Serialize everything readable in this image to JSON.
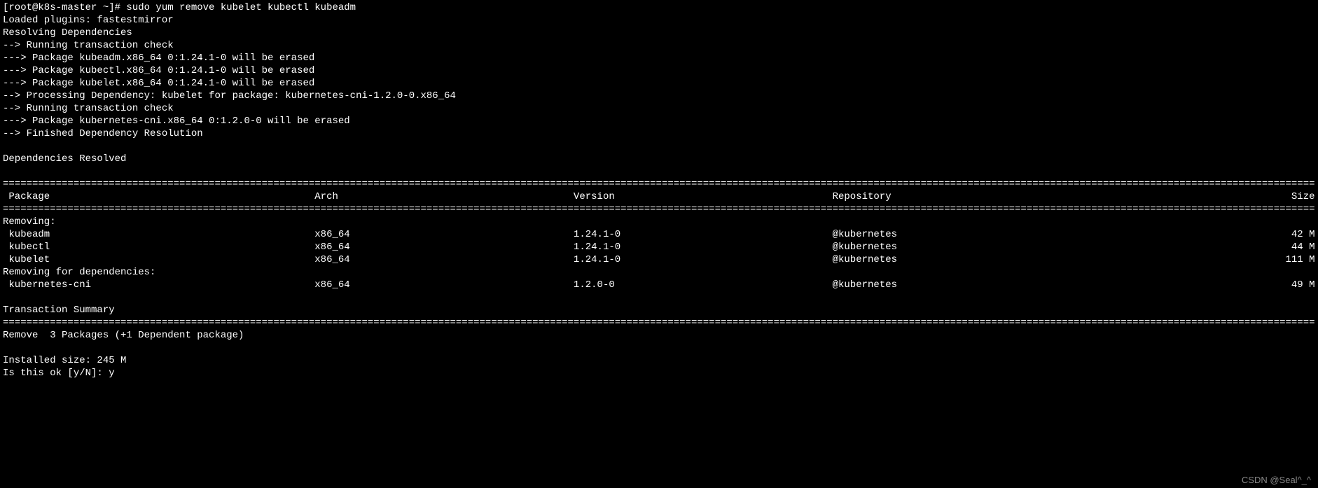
{
  "prompt_line": "[root@k8s-master ~]# sudo yum remove kubelet kubectl kubeadm",
  "header_lines": [
    "Loaded plugins: fastestmirror",
    "Resolving Dependencies",
    "--> Running transaction check",
    "---> Package kubeadm.x86_64 0:1.24.1-0 will be erased",
    "---> Package kubectl.x86_64 0:1.24.1-0 will be erased",
    "---> Package kubelet.x86_64 0:1.24.1-0 will be erased",
    "--> Processing Dependency: kubelet for package: kubernetes-cni-1.2.0-0.x86_64",
    "--> Running transaction check",
    "---> Package kubernetes-cni.x86_64 0:1.2.0-0 will be erased",
    "--> Finished Dependency Resolution",
    "",
    "Dependencies Resolved",
    ""
  ],
  "columns": {
    "package": "Package",
    "arch": "Arch",
    "version": "Version",
    "repository": "Repository",
    "size": "Size"
  },
  "section_removing": "Removing:",
  "rows_removing": [
    {
      "package": "kubeadm",
      "arch": "x86_64",
      "version": "1.24.1-0",
      "repository": "@kubernetes",
      "size": "42 M"
    },
    {
      "package": "kubectl",
      "arch": "x86_64",
      "version": "1.24.1-0",
      "repository": "@kubernetes",
      "size": "44 M"
    },
    {
      "package": "kubelet",
      "arch": "x86_64",
      "version": "1.24.1-0",
      "repository": "@kubernetes",
      "size": "111 M"
    }
  ],
  "section_removing_deps": "Removing for dependencies:",
  "rows_deps": [
    {
      "package": "kubernetes-cni",
      "arch": "x86_64",
      "version": "1.2.0-0",
      "repository": "@kubernetes",
      "size": "49 M"
    }
  ],
  "transaction_summary": "Transaction Summary",
  "summary_lines": [
    "Remove  3 Packages (+1 Dependent package)",
    "",
    "Installed size: 245 M",
    "Is this ok [y/N]: y"
  ],
  "watermark": "CSDN @Seal^_^"
}
